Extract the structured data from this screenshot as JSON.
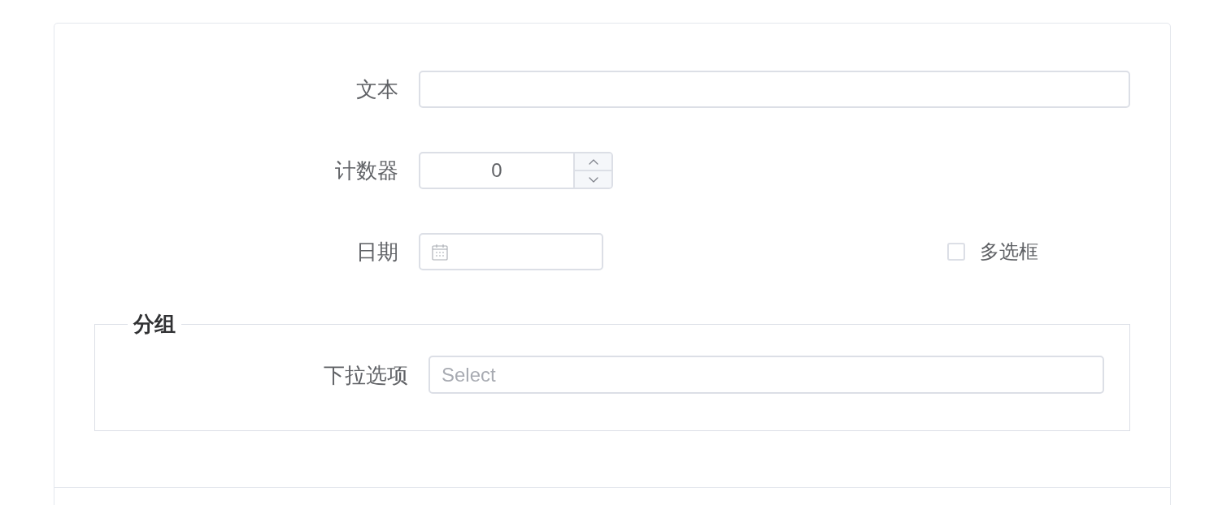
{
  "form": {
    "rows": [
      {
        "fields": [
          {
            "kind": "text",
            "label": "文本"
          }
        ]
      },
      {
        "fields": [
          {
            "kind": "number",
            "label": "计数器",
            "value": "0"
          }
        ]
      },
      {
        "fields": [
          {
            "kind": "date",
            "label": "日期"
          },
          {
            "kind": "checkbox",
            "label": "多选框",
            "checked": false
          }
        ]
      }
    ],
    "group": {
      "legend": "分组",
      "rows": [
        {
          "fields": [
            {
              "kind": "select",
              "label": "下拉选项",
              "placeholder": "Select"
            }
          ]
        }
      ]
    }
  }
}
